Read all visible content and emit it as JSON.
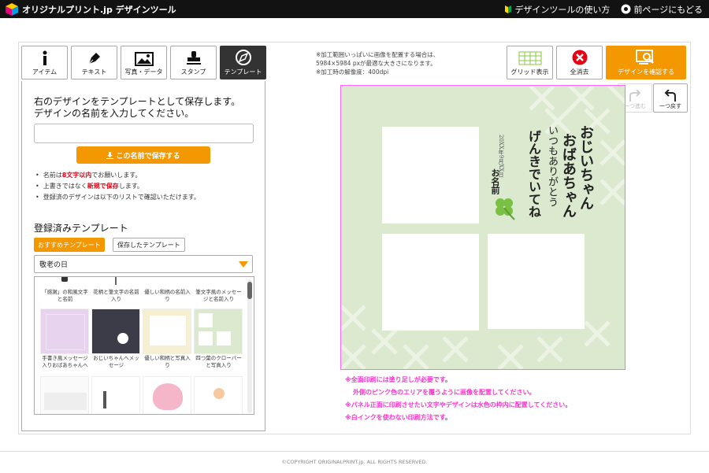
{
  "header": {
    "logo_text": "オリジナルプリント.jp デザインツール",
    "how_to": "デザインツールの使い方",
    "back": "前ページにもどる"
  },
  "tabs": [
    {
      "label": "アイテム",
      "icon": "info-icon"
    },
    {
      "label": "テキスト",
      "icon": "pen-icon"
    },
    {
      "label": "写真・データ",
      "icon": "image-icon"
    },
    {
      "label": "スタンプ",
      "icon": "stamp-icon"
    },
    {
      "label": "テンプレート",
      "icon": "template-icon",
      "active": true
    }
  ],
  "panel": {
    "title_line1": "右のデザインをテンプレートとして保存します。",
    "title_line2": "デザインの名前を入力してください。",
    "name_value": "",
    "save_label": "この名前で保存する",
    "notes": [
      {
        "pre": "名前は",
        "em": "8文字以内",
        "post": "でお願いします。"
      },
      {
        "pre": "上書きではなく",
        "em": "新規で保存",
        "post": "します。"
      },
      {
        "pre": "登録済のデザインは以下のリストで確認いただけます。",
        "em": "",
        "post": ""
      }
    ],
    "registered_title": "登録済みテンプレート",
    "tab_recommended": "おすすめテンプレート",
    "tab_saved": "保存したテンプレート",
    "category_selected": "敬老の日",
    "thumbnails": [
      {
        "caption": "「感謝」の和風文字と名前"
      },
      {
        "caption": "花柄と筆文字の名前入り"
      },
      {
        "caption": "優しい和柄の名前入り"
      },
      {
        "caption": "筆文字風のメッセージと名前入り"
      },
      {
        "caption": "手書き風メッセージ入りおばあちゃんへ"
      },
      {
        "caption": "おじいちゃんへメッセージ"
      },
      {
        "caption": "優しい和柄と写真入り"
      },
      {
        "caption": "四つ葉のクローバーと写真入り"
      },
      {
        "caption": ""
      },
      {
        "caption": ""
      },
      {
        "caption": ""
      },
      {
        "caption": ""
      }
    ]
  },
  "info": {
    "line1": "※加工範囲いっぱいに画像を配置する場合は、",
    "line2": "5984×5984 pxが最適な大きさになります。",
    "line3": "※加工時の解像度：400dpi"
  },
  "toolbar": {
    "grid": "グリッド表示",
    "clear": "全消去",
    "confirm": "デザインを確認する",
    "redo": "一つ進む",
    "undo": "一つ戻す"
  },
  "canvas": {
    "message_col1": "おじいちゃん",
    "message_col2": "おばあちゃん",
    "message_col3": "いつもありがとう",
    "message_col4": "げんきでいてね",
    "date": "20XX年9月XX日",
    "name": "お名前"
  },
  "warnings": [
    "※全面印刷には塗り足しが必要です。",
    "外側のピンク色のエリアを覆うように画像を配置してください。",
    "※パネル正面に印刷させたい文字やデザインは水色の枠内に配置してください。",
    "※白インクを使わない印刷方法です。"
  ],
  "footer": "©COPYRIGHT ORIGINALPRINT.jp. ALL RIGHTS RESERVED.",
  "colors": {
    "accent": "#f39800",
    "warning": "#ff33cc",
    "canvas_bg": "#dbe9cf",
    "clear_red": "#e60012"
  }
}
